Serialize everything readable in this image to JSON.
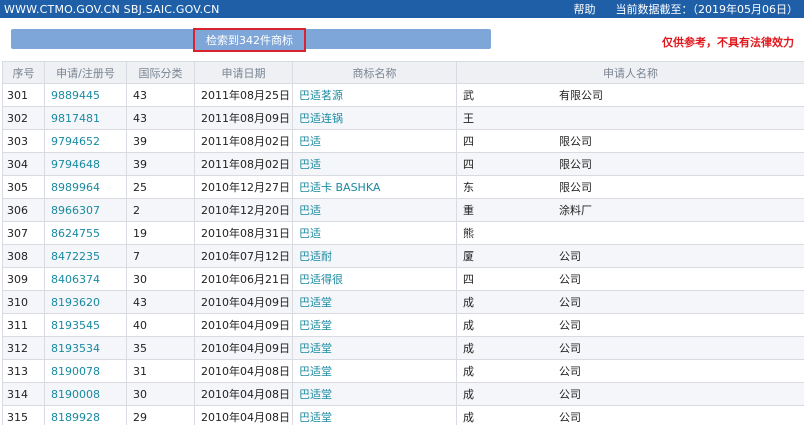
{
  "topbar": {
    "links": "WWW.CTMO.GOV.CN  SBJ.SAIC.GOV.CN",
    "help": "帮助",
    "date_label": "当前数据截至：（2019年05月06日）"
  },
  "search": {
    "result_text": "检索到342件商标",
    "disclaimer": "仅供参考，不具有法律效力"
  },
  "table": {
    "headers": [
      "序号",
      "申请/注册号",
      "国际分类",
      "申请日期",
      "商标名称",
      "申请人名称"
    ],
    "rows": [
      {
        "no": "301",
        "reg": "9889445",
        "cls": "43",
        "date": "2011年08月25日",
        "name": "巴适茗源",
        "app1": "武",
        "app2": "有限公司"
      },
      {
        "no": "302",
        "reg": "9817481",
        "cls": "43",
        "date": "2011年08月09日",
        "name": "巴适连锅",
        "app1": "王",
        "app2": ""
      },
      {
        "no": "303",
        "reg": "9794652",
        "cls": "39",
        "date": "2011年08月02日",
        "name": "巴适",
        "app1": "四",
        "app2": "限公司"
      },
      {
        "no": "304",
        "reg": "9794648",
        "cls": "39",
        "date": "2011年08月02日",
        "name": "巴适",
        "app1": "四",
        "app2": "限公司"
      },
      {
        "no": "305",
        "reg": "8989964",
        "cls": "25",
        "date": "2010年12月27日",
        "name": "巴适卡 BASHKA",
        "app1": "东",
        "app2": "限公司"
      },
      {
        "no": "306",
        "reg": "8966307",
        "cls": "2",
        "date": "2010年12月20日",
        "name": "巴适",
        "app1": "重",
        "app2": "涂料厂"
      },
      {
        "no": "307",
        "reg": "8624755",
        "cls": "19",
        "date": "2010年08月31日",
        "name": "巴适",
        "app1": "熊",
        "app2": ""
      },
      {
        "no": "308",
        "reg": "8472235",
        "cls": "7",
        "date": "2010年07月12日",
        "name": "巴适耐",
        "app1": "厦",
        "app2": "公司"
      },
      {
        "no": "309",
        "reg": "8406374",
        "cls": "30",
        "date": "2010年06月21日",
        "name": "巴适得很",
        "app1": "四",
        "app2": "公司"
      },
      {
        "no": "310",
        "reg": "8193620",
        "cls": "43",
        "date": "2010年04月09日",
        "name": "巴适堂",
        "app1": "成",
        "app2": "公司"
      },
      {
        "no": "311",
        "reg": "8193545",
        "cls": "40",
        "date": "2010年04月09日",
        "name": "巴适堂",
        "app1": "成",
        "app2": "公司"
      },
      {
        "no": "312",
        "reg": "8193534",
        "cls": "35",
        "date": "2010年04月09日",
        "name": "巴适堂",
        "app1": "成",
        "app2": "公司"
      },
      {
        "no": "313",
        "reg": "8190078",
        "cls": "31",
        "date": "2010年04月08日",
        "name": "巴适堂",
        "app1": "成",
        "app2": "公司"
      },
      {
        "no": "314",
        "reg": "8190008",
        "cls": "30",
        "date": "2010年04月08日",
        "name": "巴适堂",
        "app1": "成",
        "app2": "公司"
      },
      {
        "no": "315",
        "reg": "8189928",
        "cls": "29",
        "date": "2010年04月08日",
        "name": "巴适堂",
        "app1": "成",
        "app2": "公司"
      }
    ]
  }
}
